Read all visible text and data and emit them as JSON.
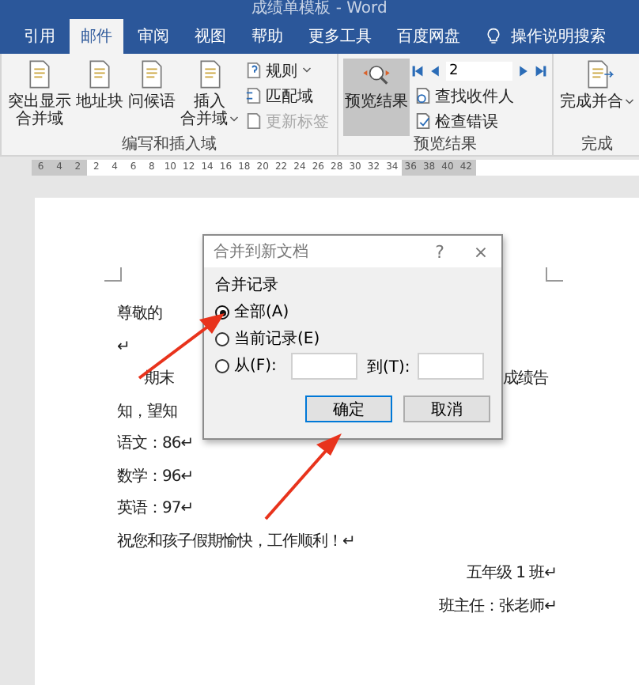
{
  "window": {
    "title": "成绩单模板 - Word"
  },
  "tabs": [
    {
      "label": "引用",
      "selected": false
    },
    {
      "label": "邮件",
      "selected": true
    },
    {
      "label": "审阅",
      "selected": false
    },
    {
      "label": "视图",
      "selected": false
    },
    {
      "label": "帮助",
      "selected": false
    },
    {
      "label": "更多工具",
      "selected": false
    },
    {
      "label": "百度网盘",
      "selected": false
    }
  ],
  "search": {
    "placeholder": "操作说明搜索"
  },
  "ribbon": {
    "groups": [
      {
        "label": "编写和插入域",
        "large": [
          {
            "lines": [
              "突出显示",
              "合并域"
            ],
            "dropdown": false
          },
          {
            "lines": [
              "地址块"
            ],
            "dropdown": false
          },
          {
            "lines": [
              "问候语"
            ],
            "dropdown": false
          },
          {
            "lines": [
              "插入",
              "合并域"
            ],
            "dropdown": true
          }
        ],
        "small": [
          {
            "label": "规则",
            "kind": "rules",
            "dropdown": true,
            "disabled": false
          },
          {
            "label": "匹配域",
            "kind": "match",
            "dropdown": false,
            "disabled": false
          },
          {
            "label": "更新标签",
            "kind": "update",
            "dropdown": false,
            "disabled": true
          }
        ]
      },
      {
        "label": "预览结果",
        "preview": {
          "label": "预览结果",
          "selected": true
        },
        "record": "2",
        "small": [
          {
            "label": "查找收件人",
            "kind": "find",
            "dropdown": false,
            "disabled": false
          },
          {
            "label": "检查错误",
            "kind": "check",
            "dropdown": false,
            "disabled": false
          }
        ]
      },
      {
        "label": "完成",
        "large": [
          {
            "lines": [
              "完成并合"
            ],
            "dropdown": true
          }
        ]
      }
    ]
  },
  "ruler": [
    {
      "label": "6",
      "margin": true
    },
    {
      "label": "4",
      "margin": true
    },
    {
      "label": "2",
      "margin": true
    },
    {
      "label": "2",
      "margin": false
    },
    {
      "label": "4",
      "margin": false
    },
    {
      "label": "6",
      "margin": false
    },
    {
      "label": "8",
      "margin": false
    },
    {
      "label": "10",
      "margin": false
    },
    {
      "label": "12",
      "margin": false
    },
    {
      "label": "14",
      "margin": false
    },
    {
      "label": "16",
      "margin": false
    },
    {
      "label": "18",
      "margin": false
    },
    {
      "label": "20",
      "margin": false
    },
    {
      "label": "22",
      "margin": false
    },
    {
      "label": "24",
      "margin": false
    },
    {
      "label": "26",
      "margin": false
    },
    {
      "label": "28",
      "margin": false
    },
    {
      "label": "30",
      "margin": false
    },
    {
      "label": "32",
      "margin": false
    },
    {
      "label": "34",
      "margin": false
    },
    {
      "label": "36",
      "margin": true
    },
    {
      "label": "38",
      "margin": true
    },
    {
      "label": "40",
      "margin": true
    },
    {
      "label": "42",
      "margin": true
    }
  ],
  "document": {
    "lines": [
      {
        "kind": "left",
        "text": "尊敬的"
      },
      {
        "kind": "left",
        "text": "↵"
      },
      {
        "kind": "split",
        "text": "期末",
        "right": "成绩告"
      },
      {
        "kind": "left",
        "text": "知，望知"
      },
      {
        "kind": "left",
        "text": "语文：86↵"
      },
      {
        "kind": "left",
        "text": "数学：96↵"
      },
      {
        "kind": "left",
        "text": "英语：97↵"
      },
      {
        "kind": "left",
        "text": "祝您和孩子假期愉快，工作顺利！↵"
      },
      {
        "kind": "right",
        "text": "五年级 1 班↵"
      },
      {
        "kind": "right",
        "text": "班主任：张老师↵"
      }
    ]
  },
  "dialog": {
    "title": "合并到新文档",
    "help": "?",
    "close": "×",
    "group": "合并记录",
    "options": [
      {
        "label": "全部(A)",
        "selected": true,
        "kind": "plain"
      },
      {
        "label": "当前记录(E)",
        "selected": false,
        "kind": "plain"
      },
      {
        "label": "从(F):",
        "selected": false,
        "kind": "range",
        "to_label": "到(T):"
      }
    ],
    "buttons": [
      {
        "label": "确定",
        "default": true
      },
      {
        "label": "取消",
        "default": false
      }
    ]
  }
}
